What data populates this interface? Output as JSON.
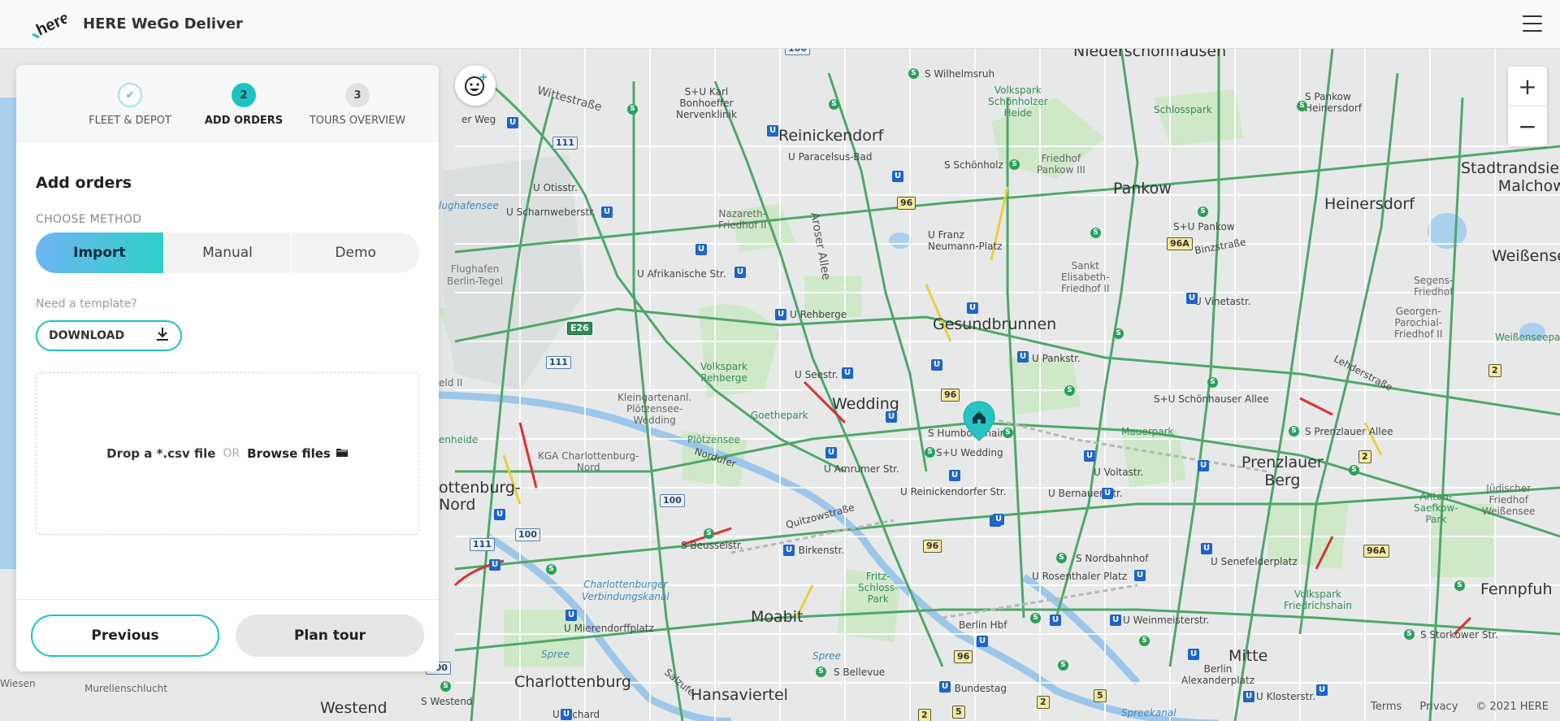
{
  "app": {
    "title": "HERE WeGo Deliver",
    "logo_text": "here"
  },
  "stepper": {
    "steps": [
      {
        "label": "FLEET & DEPOT",
        "number": "✔",
        "state": "done"
      },
      {
        "label": "ADD ORDERS",
        "number": "2",
        "state": "active"
      },
      {
        "label": "TOURS OVERVIEW",
        "number": "3",
        "state": "todo"
      }
    ]
  },
  "panel": {
    "title": "Add orders",
    "choose_method_label": "CHOOSE METHOD",
    "methods": [
      "Import",
      "Manual",
      "Demo"
    ],
    "selected_method": "Import",
    "template_prompt": "Need a template?",
    "download_label": "DOWNLOAD",
    "drop_text": "Drop a *.csv file",
    "or_text": "OR",
    "browse_text": "Browse files",
    "previous_label": "Previous",
    "plan_tour_label": "Plan tour"
  },
  "map": {
    "attribution": {
      "terms": "Terms",
      "privacy": "Privacy",
      "copyright": "© 2021 HERE"
    },
    "labels": {
      "niederschoenhausen": "Niederschönhausen",
      "reinickendorf": "Reinickendorf",
      "pankow": "Pankow",
      "heinersdorf": "Heinersdorf",
      "stadtrandsiedlung": "Stadtrandsiedlung\nMalchow",
      "weissensee": "Weißense",
      "gesundbrunnen": "Gesundbrunnen",
      "wedding": "Wedding",
      "prenzlauer_berg": "Prenzlauer\nBerg",
      "moabit": "Moabit",
      "mitte": "Mitte",
      "charlottenburg": "Charlottenburg",
      "hansaviertel": "Hansaviertel",
      "westend": "Westend",
      "fennpfuhl": "Fennpfuh",
      "charlottenburg_nord": "ottenburg-\nNord",
      "wittestrasse": "Wittestraße",
      "arose_allee": "Aroser Allee",
      "binzstrasse": "Binzstraße",
      "lehderstrasse": "Lehderstraße",
      "nordufer": "Nordufer",
      "quitzowstrasse": "Quitzowstraße",
      "salzufer": "Salzufer",
      "spree": "Spree",
      "spree2": "Spree",
      "spreekanal": "Spreekanal",
      "verbindungskanal": "Charlottenburger\nVerbindungskanal",
      "flughafen": "Flughafen\nBerlin-Tegel",
      "flughafensee": "lughafensee",
      "murellenschlucht": "Murellenschlucht",
      "volkspark_rehberge": "Volkspark\nRehberge",
      "goethepark": "Goethepark",
      "ploetzensee": "Plötzensee",
      "mauerpark": "Mauerpark",
      "schlosspark": "Schlosspark",
      "volkspark_schoenholzer": "Volkspark\nSchönholzer\nHeide",
      "friedhof_pankow": "Friedhof\nPankow III",
      "sankt_elisabeth": "Sankt\nElisabeth-\nFriedhof II",
      "nazareth": "Nazareth-\nFriedhof II",
      "kleingarten_ploetzensee": "Kleingartenanl.\nPlötzensee-\nWedding",
      "kga_charlottenburg": "KGA Charlottenburg-\nNord",
      "fritz_schloss": "Fritz-\nSchloss-\nPark",
      "volkspark_friedrichshain": "Volkspark\nFriedrichshain",
      "anton_saefkow": "Anton-\nSaefkow-\nPark",
      "georgen_parochial": "Georgen-\nParochial-\nFriedhof II",
      "segens": "Segens-\nFriedhof",
      "juedischer": "Jüdischer\nFriedhof\nWeißensee",
      "weissenseepark": "Weißenseepark",
      "s_wilhelmsruh": "S Wilhelmsruh",
      "s_u_karl_bonhoeffer": "S+U Karl\nBonhoeffer\nNervenklinik",
      "u_paracelsus": "U Paracelsus-Bad",
      "s_schoenholz": "S Schönholz",
      "s_u_pankow": "S+U Pankow",
      "s_pankow_heinersdorf": "S Pankow\nHeinersdorf",
      "u_franz_neumann": "U Franz\nNeumann-Platz",
      "u_otisstr": "U Otisstr.",
      "u_scharnweberstr": "U Scharnweberstr.",
      "u_afrikanische": "U Afrikanische Str.",
      "u_rehberge": "U Rehberge",
      "u_seestr": "U Seestr.",
      "u_vinetastr": "U Vinetastr.",
      "u_pankstr": "U Pankstr.",
      "s_u_schoenhauser": "S+U Schönhauser Allee",
      "s_prenzlauer_allee": "S Prenzlauer Allee",
      "s_humboldthain": "S Humboldthain",
      "s_u_wedding": "S+U Wedding",
      "u_voltastr": "U Voltastr.",
      "u_amrumer": "U Amrumer Str.",
      "u_reinickendorfer": "U Reinickendorfer Str.",
      "u_bernauer": "U Bernauer Str.",
      "s_beusselstr": "S Beusselstr.",
      "u_birkenstr": "U Birkenstr.",
      "s_nordbahnhof": "S Nordbahnhof",
      "u_rosenthaler": "U Rosenthaler Platz",
      "u_senefelder": "U Senefelderplatz",
      "u_mierendorff": "U Mierendorffplatz",
      "berlin_hbf": "Berlin Hbf",
      "u_weinmeister": "U Weinmeisterstr.",
      "s_storkower": "S Storkower Str.",
      "s_bellevue": "S Bellevue",
      "u_bundestag": "U Bundestag",
      "berlin_alexanderplatz": "Berlin\nAlexanderplatz",
      "u_klosterstr": "U Klosterstr.",
      "s_westend": "S Westend",
      "u_richard": "U Richard",
      "pankow_weg": "er Weg",
      "wiesen": "Wiesen",
      "eld_ii": "eld II",
      "enheide": "enheide"
    },
    "shields": [
      "96",
      "96A",
      "96A",
      "96",
      "96",
      "96",
      "2",
      "2",
      "2",
      "2",
      "5",
      "5",
      "E26",
      "111",
      "111",
      "111",
      "100",
      "100",
      "100",
      "100"
    ]
  }
}
